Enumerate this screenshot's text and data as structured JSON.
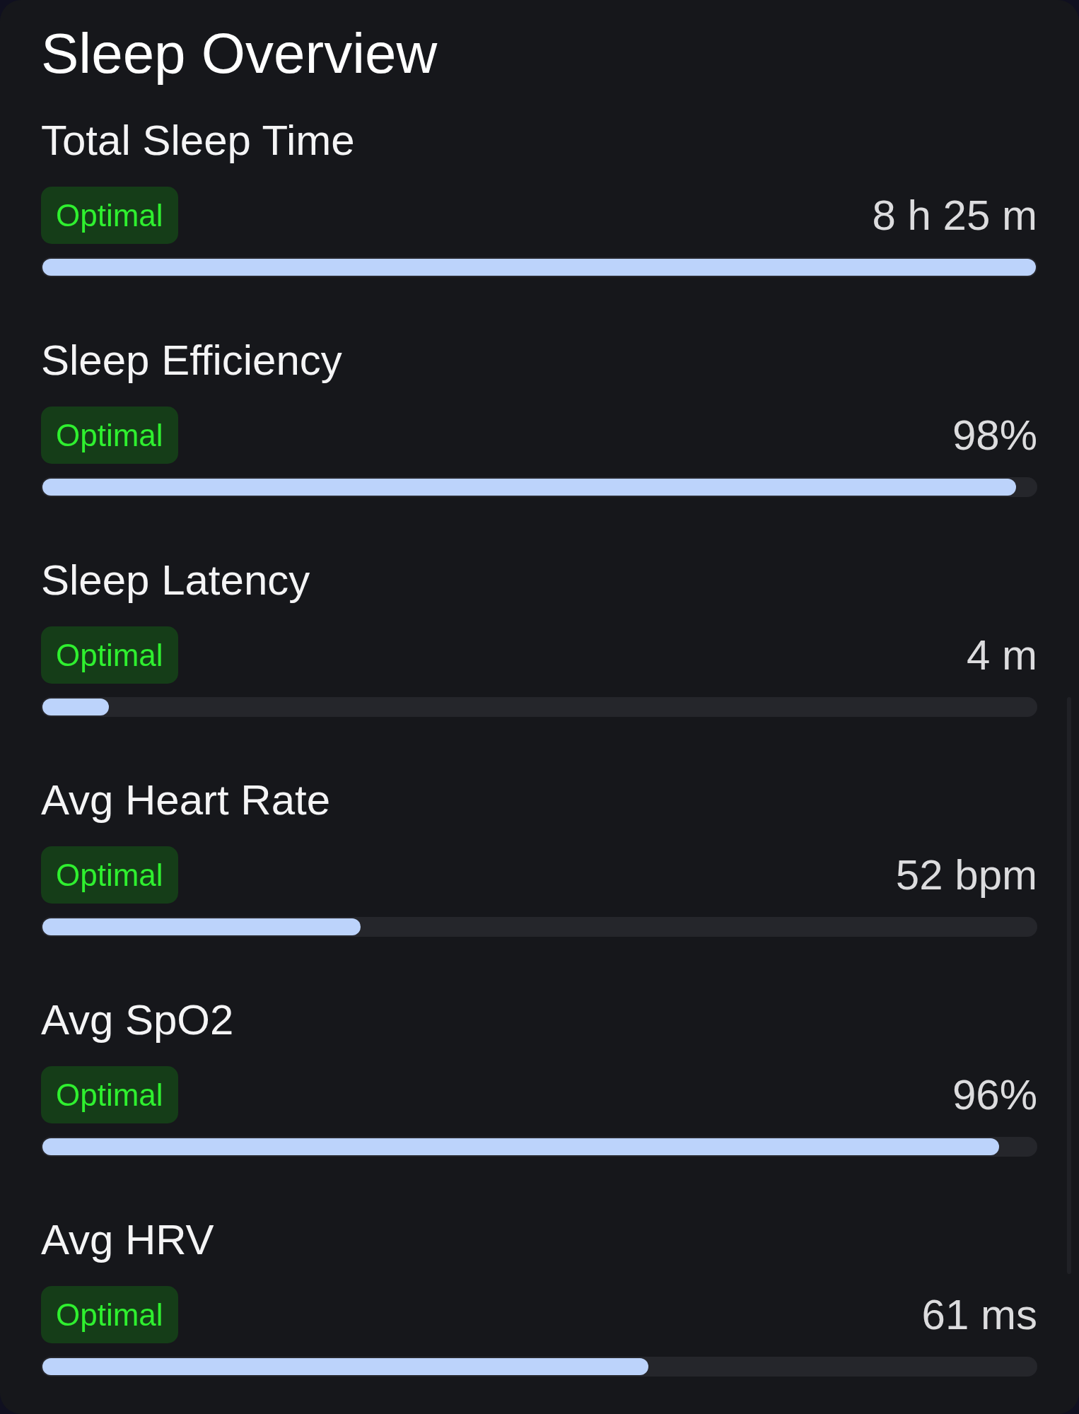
{
  "card": {
    "title": "Sleep Overview",
    "metrics": [
      {
        "label": "Total Sleep Time",
        "status": "Optimal",
        "value": "8 h 25 m",
        "level": 1
      },
      {
        "label": "Sleep Efficiency",
        "status": "Optimal",
        "value": "98%",
        "level": 0.98
      },
      {
        "label": "Sleep Latency",
        "status": "Optimal",
        "value": "4 m",
        "level": 0.067
      },
      {
        "label": "Avg Heart Rate",
        "status": "Optimal",
        "value": "52 bpm",
        "level": 0.32
      },
      {
        "label": "Avg SpO2",
        "status": "Optimal",
        "value": "96%",
        "level": 0.963
      },
      {
        "label": "Avg HRV",
        "status": "Optimal",
        "value": "61 ms",
        "level": 0.61
      }
    ]
  }
}
